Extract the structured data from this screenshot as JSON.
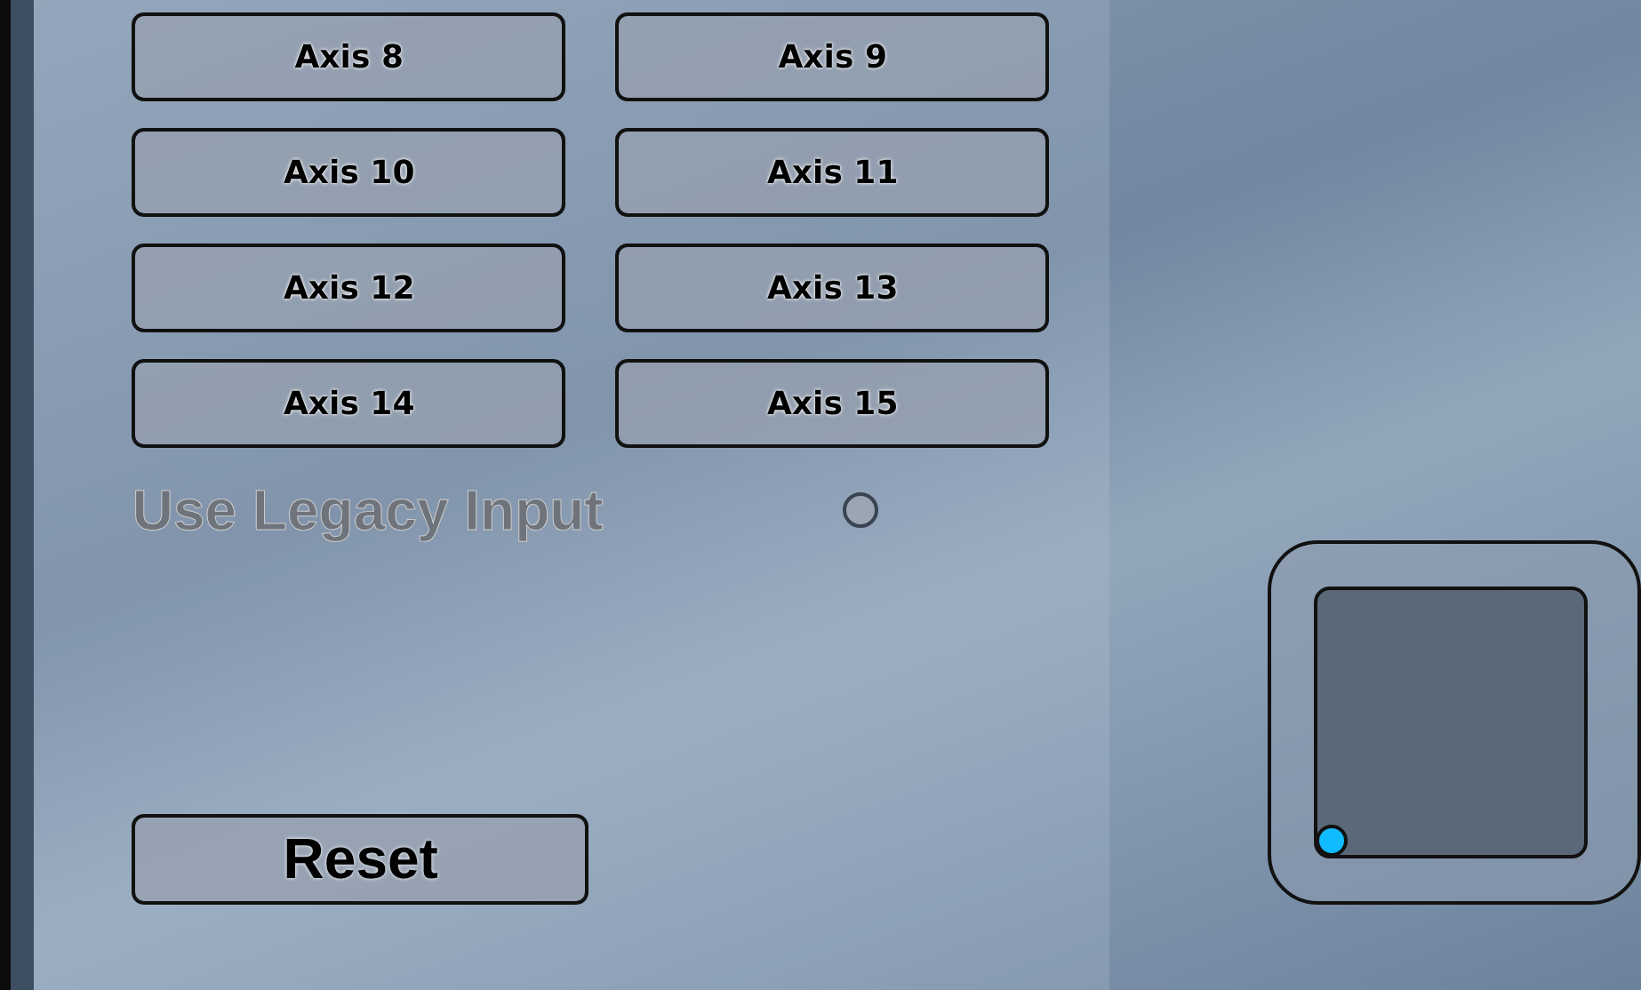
{
  "axis_buttons": [
    {
      "label": "Axis 8"
    },
    {
      "label": "Axis 9"
    },
    {
      "label": "Axis 10"
    },
    {
      "label": "Axis 11"
    },
    {
      "label": "Axis 12"
    },
    {
      "label": "Axis 13"
    },
    {
      "label": "Axis 14"
    },
    {
      "label": "Axis 15"
    }
  ],
  "legacy_input": {
    "label": "Use Legacy Input",
    "checked": false,
    "disabled": true
  },
  "reset_button": {
    "label": "Reset"
  }
}
